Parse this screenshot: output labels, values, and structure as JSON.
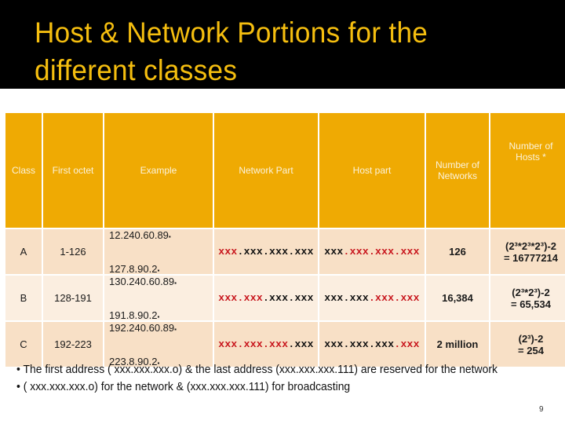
{
  "slide": {
    "title_line1": "Host & Network Portions for the",
    "title_line2": "different classes",
    "page_number": "9"
  },
  "table": {
    "headers": {
      "class": "Class",
      "first_octet": "First octet",
      "example": "Example",
      "network_part": "Network Part",
      "host_part": "Host part",
      "networks_l1": "Number of",
      "networks_l2": "Networks",
      "hosts_l1": "Number of",
      "hosts_l2": "Hosts *"
    },
    "rows": [
      {
        "class": "A",
        "first_octet": "1-126",
        "example1": "12.240.60.89",
        "example2": "127.8.90.2",
        "network_red": "xxx",
        "network_black": ".xxx.xxx.xxx",
        "host_black": "xxx",
        "host_red": ".xxx.xxx.xxx",
        "networks": "126",
        "hosts_base": "(2",
        "hosts_exp": "3",
        "hosts_formula": "(2³*2³*2³)-2",
        "hosts_result": "= 16777214"
      },
      {
        "class": "B",
        "first_octet": "128-191",
        "example1": "130.240.60.89",
        "example2": "191.8.90.2",
        "network_red": "xxx.xxx",
        "network_black": ".xxx.xxx",
        "host_black": "xxx.xxx",
        "host_red": ".xxx.xxx",
        "networks": "16,384",
        "hosts_formula": "(2³*2³)-2",
        "hosts_result": "= 65,534"
      },
      {
        "class": "C",
        "first_octet": "192-223",
        "example1": "192.240.60.89",
        "example2": "223.8.90.2",
        "network_red": "xxx.xxx.xxx",
        "network_black": ".xxx",
        "host_black": "xxx.xxx.xxx",
        "host_red": ".xxx",
        "networks": "2 million",
        "hosts_formula": "(2³)-2",
        "hosts_result": "= 254"
      }
    ],
    "bullet_marker": "▪"
  },
  "notes": {
    "line1": "• The first address ( xxx.xxx.xxx.o) & the last address (xxx.xxx.xxx.111) are reserved for the network",
    "line2": "• ( xxx.xxx.xxx.o) for the network & (xxx.xxx.xxx.111)  for broadcasting"
  },
  "colors": {
    "title_bg": "#000000",
    "title_text": "#f5be0f",
    "header_bg": "#efaa03",
    "row_odd": "#f8e0c6",
    "row_even": "#fbeee0",
    "highlight_red": "#c8161d"
  }
}
